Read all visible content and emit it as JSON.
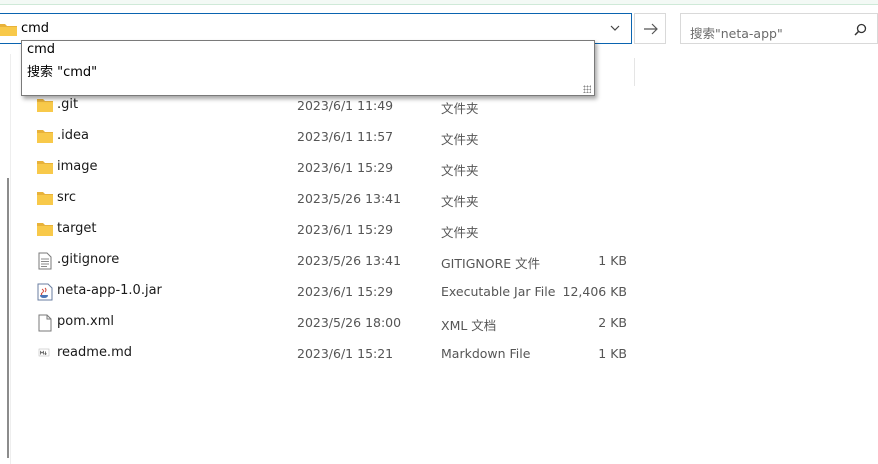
{
  "address_bar": {
    "value": "cmd"
  },
  "search": {
    "placeholder": "搜索\"neta-app\""
  },
  "suggestions": [
    "cmd",
    "搜索 \"cmd\""
  ],
  "files": [
    {
      "name": ".git",
      "date": "2023/6/1 11:49",
      "type": "文件夹",
      "size": "",
      "icon": "folder-icon"
    },
    {
      "name": ".idea",
      "date": "2023/6/1 11:57",
      "type": "文件夹",
      "size": "",
      "icon": "folder-icon"
    },
    {
      "name": "image",
      "date": "2023/6/1 15:29",
      "type": "文件夹",
      "size": "",
      "icon": "folder-icon"
    },
    {
      "name": "src",
      "date": "2023/5/26 13:41",
      "type": "文件夹",
      "size": "",
      "icon": "folder-icon"
    },
    {
      "name": "target",
      "date": "2023/6/1 15:29",
      "type": "文件夹",
      "size": "",
      "icon": "folder-icon"
    },
    {
      "name": ".gitignore",
      "date": "2023/5/26 13:41",
      "type": "GITIGNORE 文件",
      "size": "1 KB",
      "icon": "text-file-icon"
    },
    {
      "name": "neta-app-1.0.jar",
      "date": "2023/6/1 15:29",
      "type": "Executable Jar File",
      "size": "12,406 KB",
      "icon": "jar-file-icon"
    },
    {
      "name": "pom.xml",
      "date": "2023/5/26 18:00",
      "type": "XML 文档",
      "size": "2 KB",
      "icon": "blank-file-icon"
    },
    {
      "name": "readme.md",
      "date": "2023/6/1 15:21",
      "type": "Markdown File",
      "size": "1 KB",
      "icon": "markdown-file-icon"
    }
  ],
  "colors": {
    "accent": "#0a64b0",
    "folder": "#f8c94a"
  }
}
